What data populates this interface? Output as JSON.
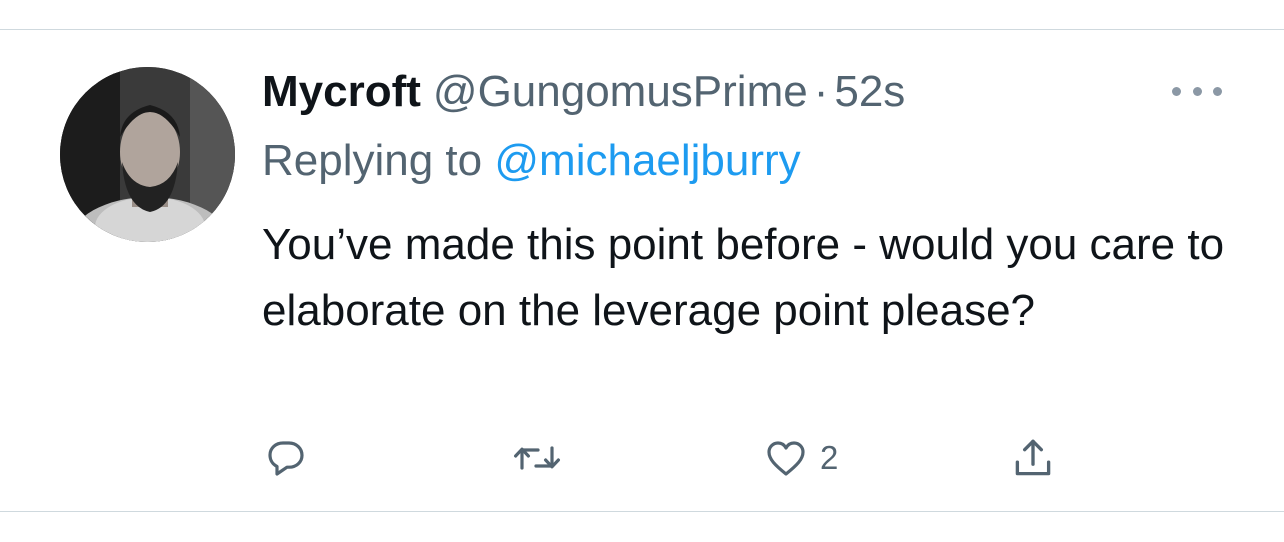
{
  "tweet": {
    "display_name": "Mycroft",
    "handle": "@GungomusPrime",
    "separator": "·",
    "time": "52s",
    "replying_label": "Replying to",
    "replying_to": "@michaeljburry",
    "text": "You’ve made this point before - would you care to elaborate on the leverage point please?",
    "actions": {
      "reply_count": "",
      "retweet_count": "",
      "like_count": "2"
    }
  },
  "icons": {
    "more": "more-horizontal-icon",
    "reply": "reply-bubble-icon",
    "retweet": "retweet-arrows-icon",
    "like": "heart-icon",
    "share": "share-upload-icon"
  },
  "colors": {
    "text": "#0f1419",
    "secondary": "#536471",
    "link": "#1d9bf0",
    "divider": "#cfd9de"
  }
}
